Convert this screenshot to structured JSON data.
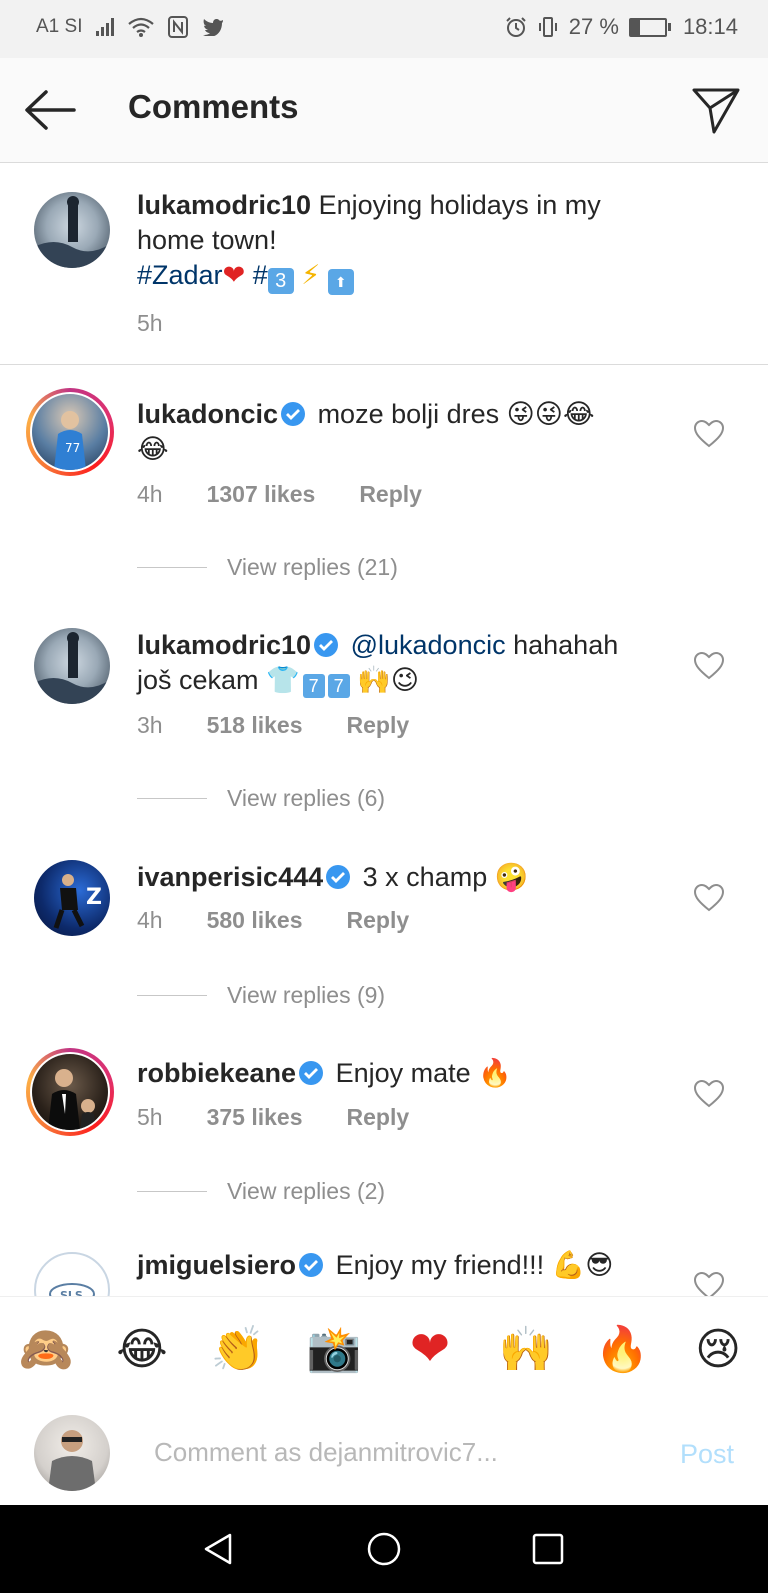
{
  "status_bar": {
    "carrier": "A1 SI",
    "battery": "27 %",
    "time": "18:14"
  },
  "header": {
    "title": "Comments"
  },
  "caption": {
    "username": "lukamodric10",
    "text": "Enjoying holidays in my",
    "text_line2": "home town!",
    "hashtag1": "#Zadar",
    "hashtag2": "#",
    "time": "5h"
  },
  "comments": [
    {
      "username": "lukadoncic",
      "text": "moze bolji dres",
      "time": "4h",
      "likes": "1307 likes",
      "reply": "Reply",
      "view_replies": "View replies (21)"
    },
    {
      "username": "lukamodric10",
      "mention": "@lukadoncic",
      "text": "hahahah",
      "text_line2": "još cekam",
      "time": "3h",
      "likes": "518 likes",
      "reply": "Reply",
      "view_replies": "View replies (6)"
    },
    {
      "username": "ivanperisic444",
      "text": "3 x champ",
      "time": "4h",
      "likes": "580 likes",
      "reply": "Reply",
      "view_replies": "View replies (9)"
    },
    {
      "username": "robbiekeane",
      "text": "Enjoy mate",
      "time": "5h",
      "likes": "375 likes",
      "reply": "Reply",
      "view_replies": "View replies (2)"
    },
    {
      "username": "jmiguelsiero",
      "text": "Enjoy my friend!!!"
    }
  ],
  "compose": {
    "placeholder": "Comment as dejanmitrovic7...",
    "post_label": "Post"
  },
  "colors": {
    "link_blue": "#003569",
    "verified_blue": "#3897f0",
    "muted_gray": "#8e8e8e",
    "post_disabled": "#b2dffc"
  }
}
